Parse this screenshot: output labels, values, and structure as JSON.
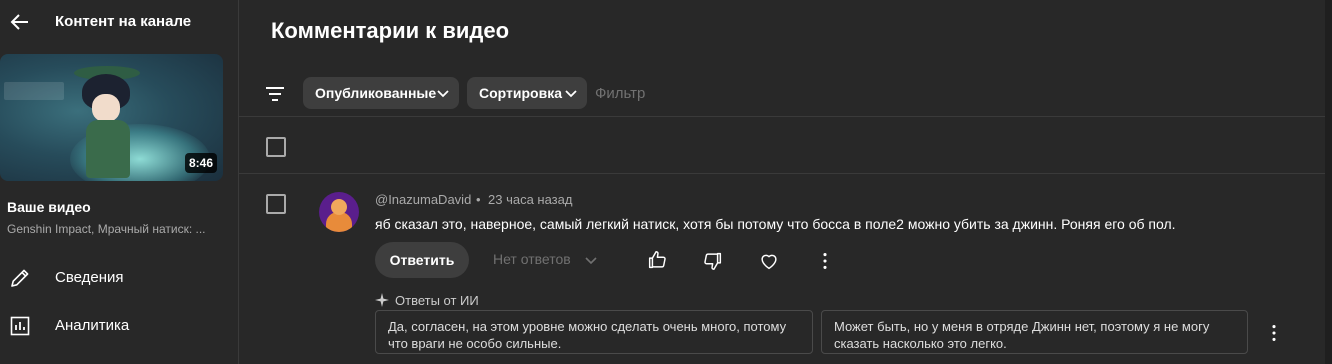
{
  "sidebar": {
    "header_title": "Контент на канале",
    "video": {
      "duration": "8:46",
      "title": "Ваше видео",
      "subtitle": "Genshin Impact, Мрачный натиск: ..."
    },
    "nav": [
      {
        "label": "Сведения",
        "icon": "pencil-icon"
      },
      {
        "label": "Аналитика",
        "icon": "analytics-icon"
      }
    ]
  },
  "main": {
    "title": "Комментарии к видео",
    "toolbar": {
      "published_label": "Опубликованные",
      "sort_label": "Сортировка",
      "filter_placeholder": "Фильтр"
    },
    "comment": {
      "author": "@InazumaDavid",
      "separator": "•",
      "time": "23 часа назад",
      "text": "яб сказал это, наверное, самый легкий натиск, хотя бы потому что босса в поле2 можно убить за джинн. Роняя его об пол.",
      "reply_label": "Ответить",
      "no_replies_label": "Нет ответов",
      "actions": [
        "thumbs-up-icon",
        "thumbs-down-icon",
        "heart-icon",
        "more-vert-icon"
      ]
    },
    "ai_replies": {
      "label": "Ответы от ИИ",
      "suggestions": [
        "Да, согласен, на этом уровне можно сделать очень много, потому что враги не особо сильные.",
        "Может быть, но у меня в отряде Джинн нет, поэтому я не могу сказать насколько это легко."
      ]
    }
  },
  "colors": {
    "background": "#282828",
    "chip": "#3e3e3e",
    "muted_text": "#aaaaaa",
    "placeholder": "#717171",
    "divider": "#3a3a3a"
  }
}
